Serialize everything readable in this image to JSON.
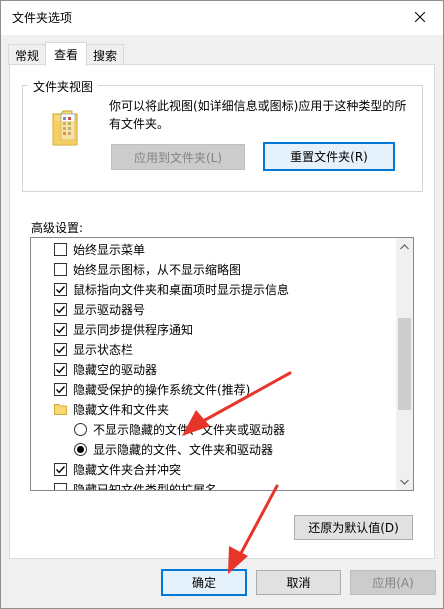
{
  "window": {
    "title": "文件夹选项"
  },
  "tabs": [
    {
      "label": "常规"
    },
    {
      "label": "查看"
    },
    {
      "label": "搜索"
    }
  ],
  "folder_views": {
    "legend": "文件夹视图",
    "description": "你可以将此视图(如详细信息或图标)应用于这种类型的所有文件夹。",
    "apply_button": "应用到文件夹(L)",
    "reset_button": "重置文件夹(R)"
  },
  "advanced": {
    "label": "高级设置:",
    "items": [
      {
        "kind": "checkbox",
        "checked": false,
        "label": "始终显示菜单"
      },
      {
        "kind": "checkbox",
        "checked": false,
        "label": "始终显示图标，从不显示缩略图"
      },
      {
        "kind": "checkbox",
        "checked": true,
        "label": "鼠标指向文件夹和桌面项时显示提示信息"
      },
      {
        "kind": "checkbox",
        "checked": true,
        "label": "显示驱动器号"
      },
      {
        "kind": "checkbox",
        "checked": true,
        "label": "显示同步提供程序通知"
      },
      {
        "kind": "checkbox",
        "checked": true,
        "label": "显示状态栏"
      },
      {
        "kind": "checkbox",
        "checked": true,
        "label": "隐藏空的驱动器"
      },
      {
        "kind": "checkbox",
        "checked": true,
        "label": "隐藏受保护的操作系统文件(推荐)"
      },
      {
        "kind": "folder",
        "label": "隐藏文件和文件夹"
      },
      {
        "kind": "radio",
        "checked": false,
        "label": "不显示隐藏的文件、文件夹或驱动器"
      },
      {
        "kind": "radio",
        "checked": true,
        "label": "显示隐藏的文件、文件夹和驱动器"
      },
      {
        "kind": "checkbox",
        "checked": true,
        "label": "隐藏文件夹合并冲突"
      },
      {
        "kind": "checkbox",
        "checked": false,
        "label": "隐藏已知文件类型的扩展名"
      }
    ],
    "restore_button": "还原为默认值(D)"
  },
  "footer": {
    "ok": "确定",
    "cancel": "取消",
    "apply": "应用(A)"
  },
  "colors": {
    "accent": "#0078d7",
    "annotation_arrow": "#e8352a"
  }
}
